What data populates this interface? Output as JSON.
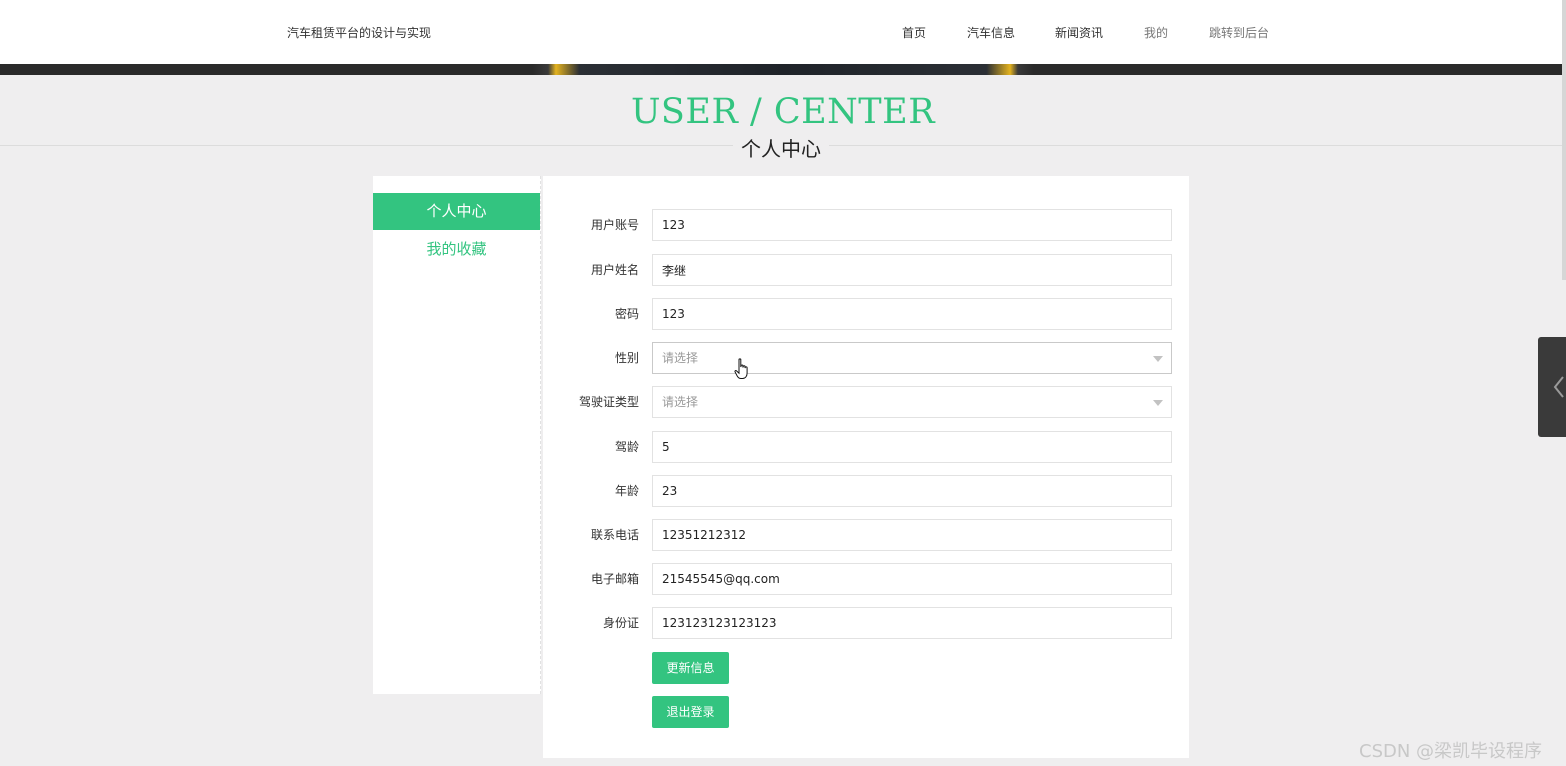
{
  "header": {
    "site_title": "汽车租赁平台的设计与实现",
    "nav": [
      {
        "label": "首页"
      },
      {
        "label": "汽车信息"
      },
      {
        "label": "新闻资讯"
      },
      {
        "label": "我的"
      },
      {
        "label": "跳转到后台"
      }
    ]
  },
  "page_heading": {
    "english": "USER / CENTER",
    "chinese": "个人中心"
  },
  "sidebar": {
    "items": [
      {
        "label": "个人中心",
        "active": true
      },
      {
        "label": "我的收藏",
        "active": false
      }
    ]
  },
  "form": {
    "fields": [
      {
        "label": "用户账号",
        "value": "123"
      },
      {
        "label": "用户姓名",
        "value": "李继"
      },
      {
        "label": "密码",
        "value": "123"
      },
      {
        "label": "性别",
        "placeholder": "请选择"
      },
      {
        "label": "驾驶证类型",
        "placeholder": "请选择"
      },
      {
        "label": "驾龄",
        "value": "5"
      },
      {
        "label": "年龄",
        "value": "23"
      },
      {
        "label": "联系电话",
        "value": "12351212312"
      },
      {
        "label": "电子邮箱",
        "value": "21545545@qq.com"
      },
      {
        "label": "身份证",
        "value": "123123123123123"
      }
    ],
    "update_button": "更新信息",
    "logout_button": "退出登录"
  },
  "watermark": "CSDN @梁凯毕设程序",
  "colors": {
    "accent": "#33c480",
    "page_bg": "#efeeef"
  }
}
